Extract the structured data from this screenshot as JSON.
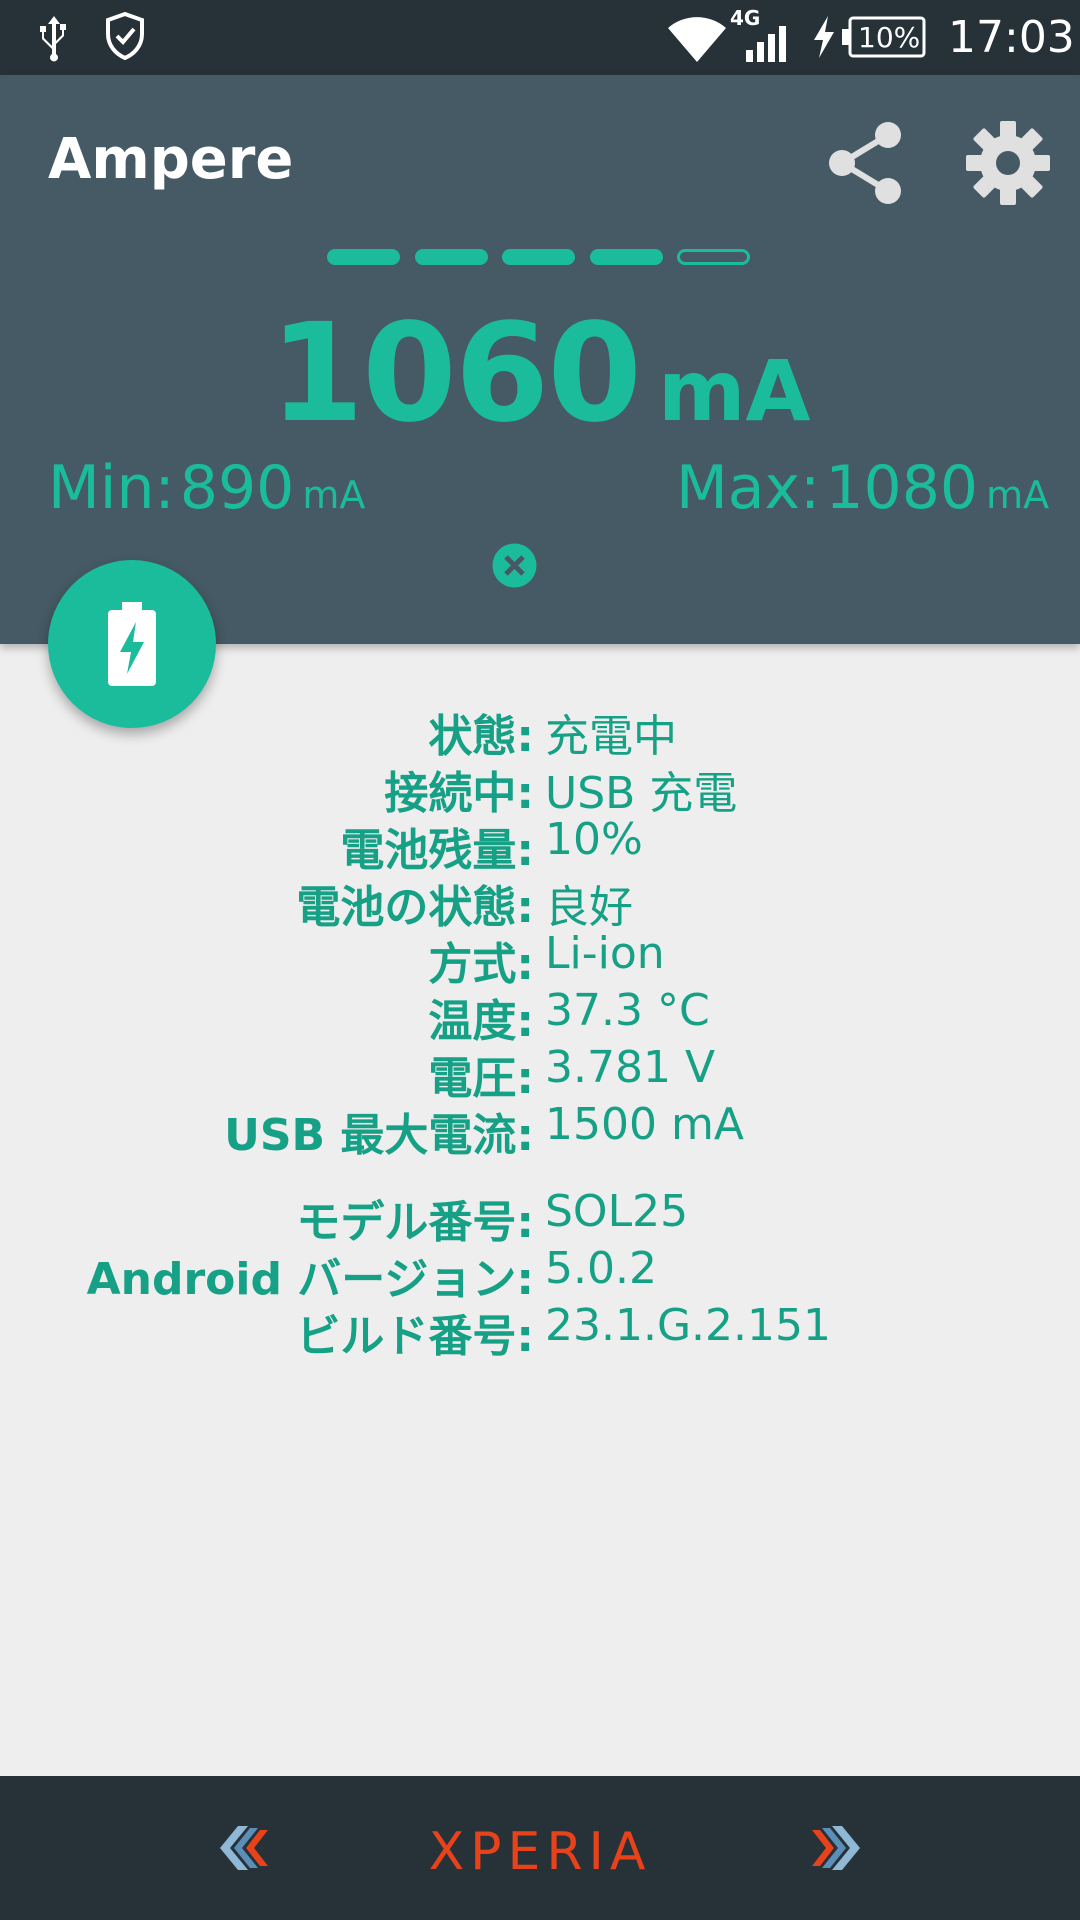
{
  "status_bar": {
    "network_type": "4G",
    "battery_percent": "10%",
    "time": "17:03"
  },
  "app": {
    "title": "Ampere"
  },
  "meter": {
    "level_filled": 4,
    "level_total": 5,
    "current_value": "1060",
    "current_unit": "mA",
    "min_label": "Min:",
    "min_value": "890",
    "min_unit": "mA",
    "max_label": "Max:",
    "max_value": "1080",
    "max_unit": "mA"
  },
  "info": [
    {
      "label": "状態:",
      "value": "充電中"
    },
    {
      "label": "接続中:",
      "value": "USB 充電"
    },
    {
      "label": "電池残量:",
      "value": "10%"
    },
    {
      "label": "電池の状態:",
      "value": "良好"
    },
    {
      "label": "方式:",
      "value": "Li-ion"
    },
    {
      "label": "温度:",
      "value": "37.3 °C"
    },
    {
      "label": "電圧:",
      "value": "3.781 V"
    },
    {
      "label": "USB 最大電流:",
      "value": "1500 mA"
    },
    {
      "label": "モデル番号:",
      "value": "SOL25"
    },
    {
      "label": "Android バージョン:",
      "value": "5.0.2"
    },
    {
      "label": "ビルド番号:",
      "value": "23.1.G.2.151"
    }
  ],
  "nav_bar": {
    "brand": "XPERIA"
  },
  "colors": {
    "accent": "#1abc9c",
    "header_bg": "#455a64",
    "status_bg": "#263238",
    "body_bg": "#eeeeee",
    "brand": "#e8421b"
  }
}
